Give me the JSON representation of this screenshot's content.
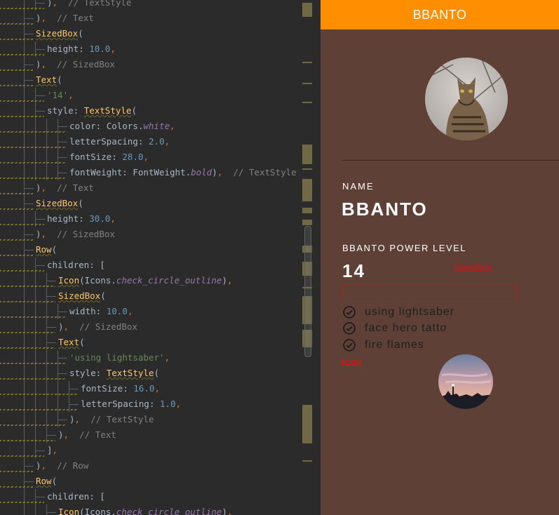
{
  "editor": {
    "lines": [
      {
        "indent": 3,
        "tokens": [
          {
            "t": ")",
            "c": "t-id"
          },
          {
            "t": ",",
            "c": "t-pun"
          },
          {
            "t": "  // TextStyle",
            "c": "t-cmt"
          }
        ]
      },
      {
        "indent": 2,
        "tokens": [
          {
            "t": ")",
            "c": "t-id"
          },
          {
            "t": ",",
            "c": "t-pun"
          },
          {
            "t": "  // Text",
            "c": "t-cmt"
          }
        ]
      },
      {
        "indent": 2,
        "tokens": [
          {
            "t": "SizedBox",
            "c": "t-kw"
          },
          {
            "t": "(",
            "c": "t-id"
          }
        ]
      },
      {
        "indent": 3,
        "tokens": [
          {
            "t": "height",
            "c": "t-prop-plain"
          },
          {
            "t": ": ",
            "c": "t-id"
          },
          {
            "t": "10.0",
            "c": "t-num"
          },
          {
            "t": ",",
            "c": "t-pun"
          }
        ]
      },
      {
        "indent": 2,
        "tokens": [
          {
            "t": ")",
            "c": "t-id"
          },
          {
            "t": ",",
            "c": "t-pun"
          },
          {
            "t": "  // SizedBox",
            "c": "t-cmt"
          }
        ]
      },
      {
        "indent": 2,
        "tokens": [
          {
            "t": "Text",
            "c": "t-kw"
          },
          {
            "t": "(",
            "c": "t-id"
          }
        ]
      },
      {
        "indent": 3,
        "tokens": [
          {
            "t": "'14'",
            "c": "t-str"
          },
          {
            "t": ",",
            "c": "t-pun"
          }
        ]
      },
      {
        "indent": 3,
        "tokens": [
          {
            "t": "style",
            "c": "t-prop-plain"
          },
          {
            "t": ": ",
            "c": "t-id"
          },
          {
            "t": "TextStyle",
            "c": "t-kw"
          },
          {
            "t": "(",
            "c": "t-id"
          }
        ]
      },
      {
        "indent": 5,
        "tokens": [
          {
            "t": "color",
            "c": "t-prop-plain"
          },
          {
            "t": ": Colors.",
            "c": "t-id"
          },
          {
            "t": "white",
            "c": "t-italic"
          },
          {
            "t": ",",
            "c": "t-pun"
          }
        ]
      },
      {
        "indent": 5,
        "tokens": [
          {
            "t": "letterSpacing",
            "c": "t-prop-plain"
          },
          {
            "t": ": ",
            "c": "t-id"
          },
          {
            "t": "2.0",
            "c": "t-num"
          },
          {
            "t": ",",
            "c": "t-pun"
          }
        ]
      },
      {
        "indent": 5,
        "tokens": [
          {
            "t": "fontSize",
            "c": "t-prop-plain"
          },
          {
            "t": ": ",
            "c": "t-id"
          },
          {
            "t": "28.0",
            "c": "t-num"
          },
          {
            "t": ",",
            "c": "t-pun"
          }
        ]
      },
      {
        "indent": 5,
        "tokens": [
          {
            "t": "fontWeight",
            "c": "t-prop-plain"
          },
          {
            "t": ": FontWeight.",
            "c": "t-id"
          },
          {
            "t": "bold",
            "c": "t-italic"
          },
          {
            "t": ")",
            "c": "t-id"
          },
          {
            "t": ",",
            "c": "t-pun"
          },
          {
            "t": "  // TextStyle",
            "c": "t-cmt"
          }
        ]
      },
      {
        "indent": 2,
        "tokens": [
          {
            "t": ")",
            "c": "t-id"
          },
          {
            "t": ",",
            "c": "t-pun"
          },
          {
            "t": "  // Text",
            "c": "t-cmt"
          }
        ]
      },
      {
        "indent": 2,
        "tokens": [
          {
            "t": "SizedBox",
            "c": "t-kw"
          },
          {
            "t": "(",
            "c": "t-id"
          }
        ]
      },
      {
        "indent": 3,
        "tokens": [
          {
            "t": "height",
            "c": "t-prop-plain"
          },
          {
            "t": ": ",
            "c": "t-id"
          },
          {
            "t": "30.0",
            "c": "t-num"
          },
          {
            "t": ",",
            "c": "t-pun"
          }
        ]
      },
      {
        "indent": 2,
        "tokens": [
          {
            "t": ")",
            "c": "t-id"
          },
          {
            "t": ",",
            "c": "t-pun"
          },
          {
            "t": "  // SizedBox",
            "c": "t-cmt"
          }
        ]
      },
      {
        "indent": 2,
        "tokens": [
          {
            "t": "Row",
            "c": "t-kw"
          },
          {
            "t": "(",
            "c": "t-id"
          }
        ]
      },
      {
        "indent": 3,
        "tokens": [
          {
            "t": "children",
            "c": "t-prop-plain"
          },
          {
            "t": ": [",
            "c": "t-id"
          }
        ]
      },
      {
        "indent": 4,
        "tokens": [
          {
            "t": "Icon",
            "c": "t-kw"
          },
          {
            "t": "(Icons.",
            "c": "t-id"
          },
          {
            "t": "check_circle_outline",
            "c": "t-italic"
          },
          {
            "t": ")",
            "c": "t-id"
          },
          {
            "t": ",",
            "c": "t-pun"
          }
        ]
      },
      {
        "indent": 4,
        "tokens": [
          {
            "t": "SizedBox",
            "c": "t-kw"
          },
          {
            "t": "(",
            "c": "t-id"
          }
        ]
      },
      {
        "indent": 5,
        "tokens": [
          {
            "t": "width",
            "c": "t-prop-plain"
          },
          {
            "t": ": ",
            "c": "t-id"
          },
          {
            "t": "10.0",
            "c": "t-num"
          },
          {
            "t": ",",
            "c": "t-pun"
          }
        ]
      },
      {
        "indent": 4,
        "tokens": [
          {
            "t": ")",
            "c": "t-id"
          },
          {
            "t": ",",
            "c": "t-pun"
          },
          {
            "t": "  // SizedBox",
            "c": "t-cmt"
          }
        ]
      },
      {
        "indent": 4,
        "tokens": [
          {
            "t": "Text",
            "c": "t-kw"
          },
          {
            "t": "(",
            "c": "t-id"
          }
        ]
      },
      {
        "indent": 5,
        "tokens": [
          {
            "t": "'using lightsaber'",
            "c": "t-str"
          },
          {
            "t": ",",
            "c": "t-pun"
          }
        ]
      },
      {
        "indent": 5,
        "tokens": [
          {
            "t": "style",
            "c": "t-prop-plain"
          },
          {
            "t": ": ",
            "c": "t-id"
          },
          {
            "t": "TextStyle",
            "c": "t-kw"
          },
          {
            "t": "(",
            "c": "t-id"
          }
        ]
      },
      {
        "indent": 6,
        "tokens": [
          {
            "t": "fontSize",
            "c": "t-prop-plain"
          },
          {
            "t": ": ",
            "c": "t-id"
          },
          {
            "t": "16.0",
            "c": "t-num"
          },
          {
            "t": ",",
            "c": "t-pun"
          }
        ]
      },
      {
        "indent": 6,
        "tokens": [
          {
            "t": "letterSpacing",
            "c": "t-prop-plain"
          },
          {
            "t": ": ",
            "c": "t-id"
          },
          {
            "t": "1.0",
            "c": "t-num"
          },
          {
            "t": ",",
            "c": "t-pun"
          }
        ]
      },
      {
        "indent": 5,
        "tokens": [
          {
            "t": ")",
            "c": "t-id"
          },
          {
            "t": ",",
            "c": "t-pun"
          },
          {
            "t": "  // TextStyle",
            "c": "t-cmt"
          }
        ]
      },
      {
        "indent": 4,
        "tokens": [
          {
            "t": ")",
            "c": "t-id"
          },
          {
            "t": ",",
            "c": "t-pun"
          },
          {
            "t": "  // Text",
            "c": "t-cmt"
          }
        ]
      },
      {
        "indent": 3,
        "tokens": [
          {
            "t": "]",
            "c": "t-id"
          },
          {
            "t": ",",
            "c": "t-pun"
          }
        ]
      },
      {
        "indent": 2,
        "tokens": [
          {
            "t": ")",
            "c": "t-id"
          },
          {
            "t": ",",
            "c": "t-pun"
          },
          {
            "t": "  // Row",
            "c": "t-cmt"
          }
        ]
      },
      {
        "indent": 2,
        "tokens": [
          {
            "t": "Row",
            "c": "t-kw"
          },
          {
            "t": "(",
            "c": "t-id"
          }
        ]
      },
      {
        "indent": 3,
        "tokens": [
          {
            "t": "children",
            "c": "t-prop-plain"
          },
          {
            "t": ": [",
            "c": "t-id"
          }
        ]
      },
      {
        "indent": 4,
        "tokens": [
          {
            "t": "Icon",
            "c": "t-kw"
          },
          {
            "t": "(Icons.",
            "c": "t-id"
          },
          {
            "t": "check_circle_outline",
            "c": "t-italic"
          },
          {
            "t": ")",
            "c": "t-id"
          },
          {
            "t": ",",
            "c": "t-pun"
          }
        ]
      }
    ]
  },
  "app": {
    "title": "BBANTO",
    "name_label": "NAME",
    "name_value": "BBANTO",
    "power_label": "BBANTO POWER LEVEL",
    "power_value": "14",
    "debug_sizedbox": "SizedBox",
    "debug_icon": "Icon",
    "skills": [
      {
        "icon": "check-circle-outline-icon",
        "label": "using lightsaber"
      },
      {
        "icon": "check-circle-outline-icon",
        "label": "face hero tatto"
      },
      {
        "icon": "check-circle-outline-icon",
        "label": "fire flames"
      }
    ],
    "colors": {
      "appbar": "#ff8f00",
      "background": "#5e4037",
      "debug": "#d11111"
    }
  }
}
